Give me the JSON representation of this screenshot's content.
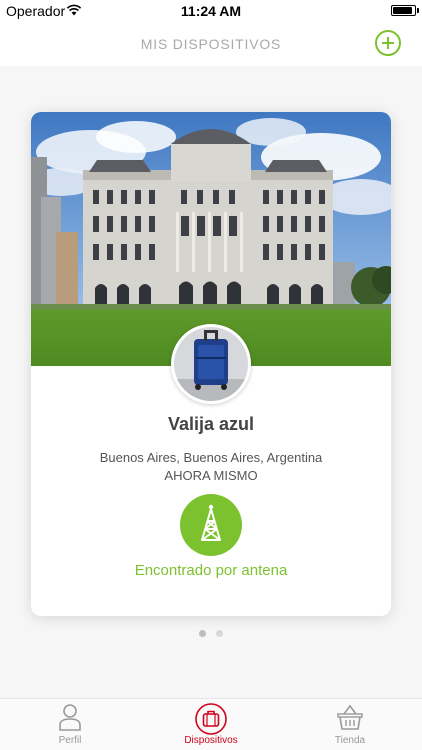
{
  "status_bar": {
    "carrier": "Operador",
    "time": "11:24 AM",
    "battery_level": 0.9
  },
  "header": {
    "title": "MIS DISPOSITIVOS",
    "add_icon": "plus-circle-icon"
  },
  "device_card": {
    "name": "Valija azul",
    "location": "Buenos Aires, Buenos Aires, Argentina",
    "last_seen": "AHORA MISMO",
    "status_icon": "antenna-icon",
    "status_text": "Encontrado por antena",
    "accent_color": "#7cc22f"
  },
  "pagination": {
    "current": 1,
    "total": 2
  },
  "tabs": [
    {
      "label": "Perfil",
      "icon": "person-icon",
      "active": false
    },
    {
      "label": "Dispositivos",
      "icon": "suitcase-icon",
      "active": true
    },
    {
      "label": "Tienda",
      "icon": "basket-icon",
      "active": false
    }
  ],
  "colors": {
    "accent": "#7cc22f",
    "active_tab": "#d0021b"
  }
}
